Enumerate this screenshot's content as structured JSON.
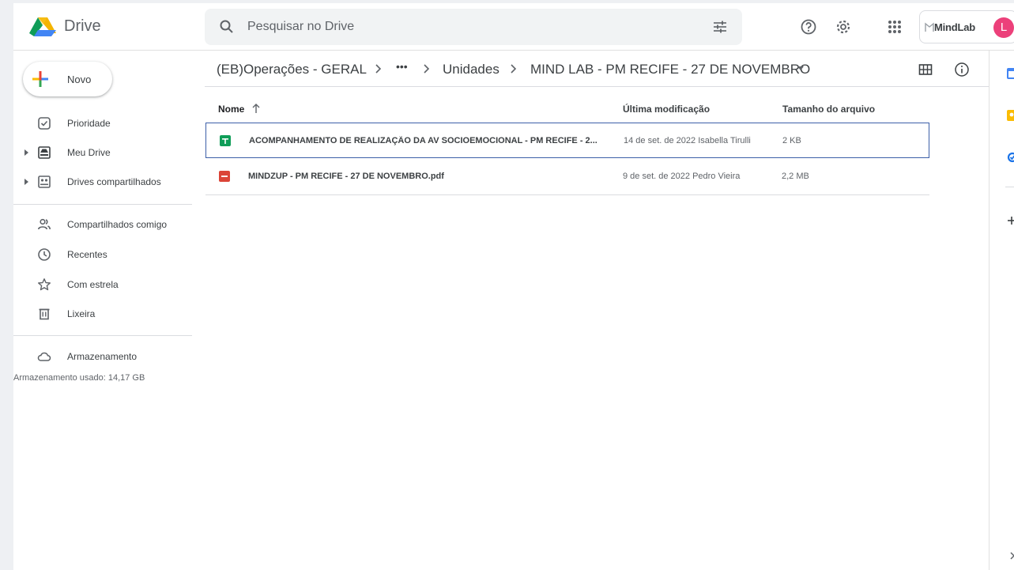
{
  "app": {
    "brand": "Drive",
    "colors": {
      "blue": "#4285f4",
      "green": "#0f9d58",
      "yellow": "#f4b400",
      "red": "#db4437",
      "selection": "#3c5fa8",
      "avatar": "#ec407a"
    }
  },
  "header": {
    "search_placeholder": "Pesquisar no Drive",
    "org_label": "MindLab",
    "avatar_letter": "L",
    "icons": [
      "search-icon",
      "filter-options-icon",
      "help-icon",
      "settings-icon",
      "apps-grid-icon"
    ]
  },
  "sidebar": {
    "new_label": "Novo",
    "items": [
      {
        "label": "Prioridade",
        "icon": "priority-check-icon"
      },
      {
        "label": "Meu Drive",
        "icon": "my-drive-icon"
      },
      {
        "label": "Drives compartilhados",
        "icon": "shared-drives-icon"
      },
      {
        "label": "Compartilhados comigo",
        "icon": "shared-with-me-icon"
      },
      {
        "label": "Recentes",
        "icon": "clock-icon"
      },
      {
        "label": "Com estrela",
        "icon": "star-icon"
      },
      {
        "label": "Lixeira",
        "icon": "trash-icon"
      },
      {
        "label": "Armazenamento",
        "icon": "cloud-icon"
      }
    ],
    "storage_used": "Armazenamento usado: 14,17 GB"
  },
  "breadcrumb": {
    "items": [
      "(EB)Operações - GERAL",
      "•••",
      "Unidades",
      "MIND LAB - PM RECIFE - 27 DE NOVEMBRO"
    ]
  },
  "table": {
    "columns": [
      "Nome",
      "Última modificação",
      "Tamanho do arquivo"
    ],
    "rows": [
      {
        "name": "ACOMPANHAMENTO DE REALIZAÇÃO DA AV SOCIOEMOCIONAL - PM RECIFE - 2...",
        "modified": "14 de set. de 2022 Isabella Tirulli",
        "size": "2 KB",
        "type": "sheets-icon"
      },
      {
        "name": "MINDZUP - PM RECIFE - 27 DE NOVEMBRO.pdf",
        "modified": "9 de set. de 2022 Pedro Vieira",
        "size": "2,2 MB",
        "type": "pdf-icon"
      }
    ]
  }
}
